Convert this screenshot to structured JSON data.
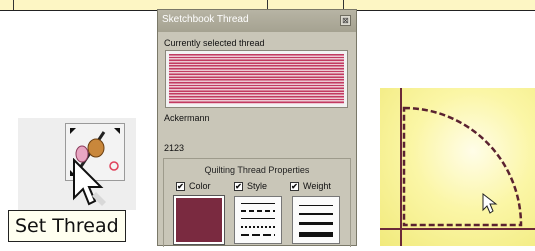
{
  "window": {
    "title": "Sketchbook Thread",
    "close_glyph": "⊠",
    "current_label": "Currently selected thread",
    "brand": "Ackermann",
    "code": "2123",
    "swatch_color": "#c23a62",
    "thread_color": "#7a2a40"
  },
  "properties": {
    "title": "Quilting Thread Properties",
    "checks": [
      {
        "label": "Color",
        "checked": true
      },
      {
        "label": "Style",
        "checked": true
      },
      {
        "label": "Weight",
        "checked": true
      }
    ],
    "check_glyph": "✔"
  },
  "tool": {
    "icon": "set-thread-icon",
    "tooltip": "Set Thread"
  },
  "colors": {
    "canvas_yellow": "#fbf6a6",
    "stitch_line": "#5a2230"
  }
}
